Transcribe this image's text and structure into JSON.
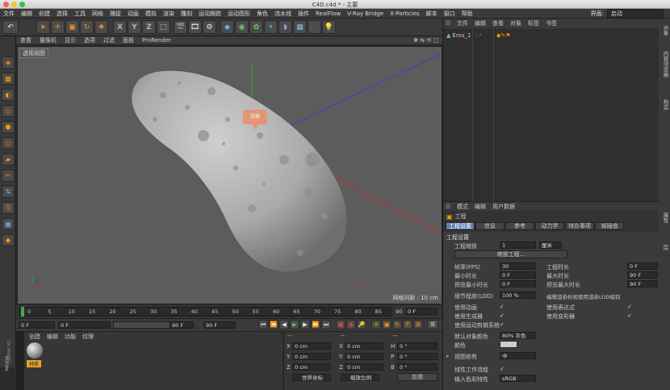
{
  "window": {
    "title": "C4D.c4d * - 主要"
  },
  "menubar": {
    "items": [
      "文件",
      "编辑",
      "创建",
      "选择",
      "工具",
      "网格",
      "捕捉",
      "动画",
      "模拟",
      "渲染",
      "雕刻",
      "运动跟踪",
      "运动图形",
      "角色",
      "流水线",
      "插件",
      "RealFlow",
      "V-Ray Bridge",
      "X-Particles",
      "脚本",
      "窗口",
      "帮助"
    ],
    "layout_label": "界面:",
    "layout_value": "启动"
  },
  "viewport": {
    "menu": [
      "查看",
      "摄像机",
      "显示",
      "选项",
      "过滤",
      "面板",
      "ProRender"
    ],
    "label": "透视视图",
    "annotation": "注释",
    "grid_spacing": "网格间距 : 10 cm"
  },
  "timeline": {
    "ticks": [
      "0",
      "5",
      "10",
      "15",
      "20",
      "25",
      "30",
      "35",
      "40",
      "45",
      "50",
      "55",
      "60",
      "65",
      "70",
      "75",
      "80",
      "85",
      "90"
    ],
    "end_field": "0 F",
    "start_frame": "0 F",
    "current_frame": "0 F",
    "end_frame": "90 F",
    "max_frame": "90 F"
  },
  "material_panel": {
    "menu": [
      "创建",
      "编辑",
      "功能",
      "纹理"
    ],
    "material_name": "材质",
    "brand_1": "MAXON",
    "brand_2": "CINEMA 4D"
  },
  "coords": {
    "header_1": "--",
    "header_2": "--",
    "header_3": "--",
    "rows": [
      {
        "a_label": "X",
        "a_val": "0 cm",
        "b_label": "X",
        "b_val": "0 cm",
        "c_label": "H",
        "c_val": "0 °"
      },
      {
        "a_label": "Y",
        "a_val": "0 cm",
        "b_label": "Y",
        "b_val": "0 cm",
        "c_label": "P",
        "c_val": "0 °"
      },
      {
        "a_label": "Z",
        "a_val": "0 cm",
        "b_label": "Z",
        "b_val": "0 cm",
        "c_label": "B",
        "c_val": "0 °"
      }
    ],
    "world_select": "世界坐标",
    "scale_select": "缩放比例",
    "apply_button": "应用"
  },
  "object_manager": {
    "menu": [
      "文件",
      "编辑",
      "查看",
      "对象",
      "标签",
      "书签"
    ],
    "object_name": "Eros_1"
  },
  "attribute_manager": {
    "menu": [
      "模式",
      "编辑",
      "用户数据"
    ],
    "title": "工程",
    "tabs": [
      "工程设置",
      "信息",
      "参考",
      "动力学",
      "待办事项",
      "帧插值"
    ],
    "section": "工程设置",
    "scale_label": "工程缩放",
    "scale_value": "1",
    "scale_unit": "厘米",
    "scale_button": "缩放工程...",
    "fps_label": "帧率(FPS)",
    "fps_value": "30",
    "project_time_label": "工程时长",
    "project_time_value": "0 F",
    "min_time_label": "最小时长",
    "min_time_value": "0 F",
    "max_time_label": "最大时长",
    "max_time_value": "90 F",
    "preview_min_label": "预览最小时长",
    "preview_min_value": "0 F",
    "preview_max_label": "预览最大时长",
    "preview_max_value": "90 F",
    "lod_label": "细节程度(LOD)",
    "lod_value": "100 %",
    "lod_render_label": "编辑渲染检视使用渲染LOD级别",
    "use_anim_label": "使用动画",
    "use_expr_label": "使用表达式",
    "use_gen_label": "使用生成器",
    "use_deform_label": "使用变形器",
    "use_motion_label": "使用运动剪辑系统",
    "default_color_label": "默认对象颜色",
    "default_color_value": "80% 灰色",
    "color_label": "颜色",
    "view_clip_label": "视图修剪",
    "view_clip_value": "中",
    "linear_label": "线性工作流程",
    "input_color_label": "输入色彩特性",
    "input_color_value": "sRGB",
    "check_mark": "✓"
  },
  "side_tabs": [
    "对象",
    "内容浏览器",
    "构造",
    "属性",
    "层"
  ],
  "colors": {
    "accent": "#e7a52a",
    "selected_tab": "#5b7fae",
    "viewport_bg": "#5c5c5c"
  }
}
